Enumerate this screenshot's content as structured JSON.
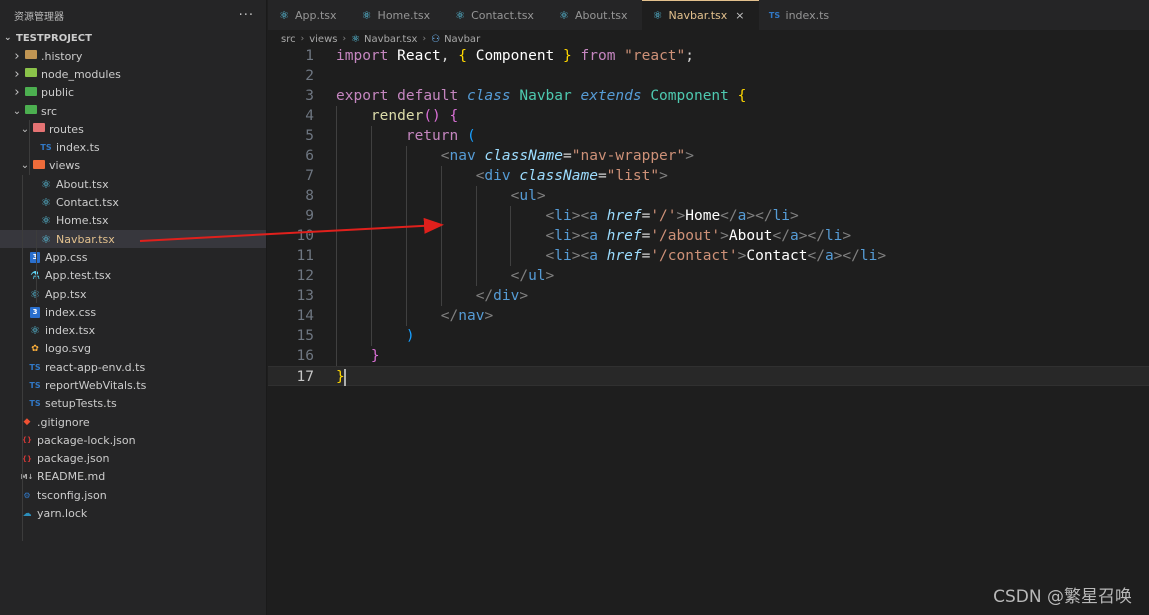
{
  "sidebar": {
    "title": "资源管理器",
    "more": "···",
    "project": "TESTPROJECT",
    "items": [
      {
        "label": ".history",
        "type": "folder",
        "depth": 0,
        "open": false
      },
      {
        "label": "node_modules",
        "type": "folder",
        "depth": 0,
        "open": false
      },
      {
        "label": "public",
        "type": "folder",
        "depth": 0,
        "open": false
      },
      {
        "label": "src",
        "type": "folder",
        "depth": 0,
        "open": true
      },
      {
        "label": "routes",
        "type": "folder",
        "depth": 1,
        "open": true
      },
      {
        "label": "index.ts",
        "type": "ts",
        "depth": 2
      },
      {
        "label": "views",
        "type": "folder",
        "depth": 1,
        "open": true
      },
      {
        "label": "About.tsx",
        "type": "react",
        "depth": 2
      },
      {
        "label": "Contact.tsx",
        "type": "react",
        "depth": 2
      },
      {
        "label": "Home.tsx",
        "type": "react",
        "depth": 2
      },
      {
        "label": "Navbar.tsx",
        "type": "react",
        "depth": 2,
        "selected": true
      },
      {
        "label": "App.css",
        "type": "css",
        "depth": 1
      },
      {
        "label": "App.test.tsx",
        "type": "test",
        "depth": 1
      },
      {
        "label": "App.tsx",
        "type": "react",
        "depth": 1
      },
      {
        "label": "index.css",
        "type": "css",
        "depth": 1
      },
      {
        "label": "index.tsx",
        "type": "react",
        "depth": 1
      },
      {
        "label": "logo.svg",
        "type": "svg",
        "depth": 1
      },
      {
        "label": "react-app-env.d.ts",
        "type": "ts",
        "depth": 1
      },
      {
        "label": "reportWebVitals.ts",
        "type": "ts",
        "depth": 1
      },
      {
        "label": "setupTests.ts",
        "type": "ts",
        "depth": 1
      },
      {
        "label": ".gitignore",
        "type": "git",
        "depth": 0
      },
      {
        "label": "package-lock.json",
        "type": "json",
        "depth": 0
      },
      {
        "label": "package.json",
        "type": "json",
        "depth": 0
      },
      {
        "label": "README.md",
        "type": "md",
        "depth": 0
      },
      {
        "label": "tsconfig.json",
        "type": "tsconfig",
        "depth": 0
      },
      {
        "label": "yarn.lock",
        "type": "yarn",
        "depth": 0
      }
    ]
  },
  "icons": {
    "ts": "TS",
    "css": "3",
    "json": "{}",
    "md": "M↓",
    "folder_closed": "›",
    "folder_open": "⌄",
    "close": "×"
  },
  "tabs": [
    {
      "label": "App.tsx",
      "icon": "react-icon"
    },
    {
      "label": "Home.tsx",
      "icon": "react-icon"
    },
    {
      "label": "Contact.tsx",
      "icon": "react-icon"
    },
    {
      "label": "About.tsx",
      "icon": "react-icon"
    },
    {
      "label": "Navbar.tsx",
      "icon": "react-icon",
      "active": true
    },
    {
      "label": "index.ts",
      "icon": "ts-icon"
    }
  ],
  "breadcrumb": [
    "src",
    "views",
    "Navbar.tsx",
    "Navbar"
  ],
  "code": {
    "line_numbers": [
      "1",
      "2",
      "3",
      "4",
      "5",
      "6",
      "7",
      "8",
      "9",
      "10",
      "11",
      "12",
      "13",
      "14",
      "15",
      "16",
      "17"
    ],
    "current_line": 17,
    "lines": [
      "import React, { Component } from \"react\";",
      "",
      "export default class Navbar extends Component {",
      "    render() {",
      "        return (",
      "            <nav className=\"nav-wrapper\">",
      "                <div className=\"list\">",
      "                    <ul>",
      "                        <li><a href='/'>Home</a></li>",
      "                        <li><a href='/about'>About</a></li>",
      "                        <li><a href='/contact'>Contact</a></li>",
      "                    </ul>",
      "                </div>",
      "            </nav>",
      "        )",
      "    }",
      "}"
    ]
  },
  "watermark": "CSDN @繁星召唤",
  "colors": {
    "accent_tab": "#e2c08d",
    "annotation_arrow": "#e0201c",
    "sidebar_bg": "#252526",
    "editor_bg": "#1e1e1e"
  }
}
